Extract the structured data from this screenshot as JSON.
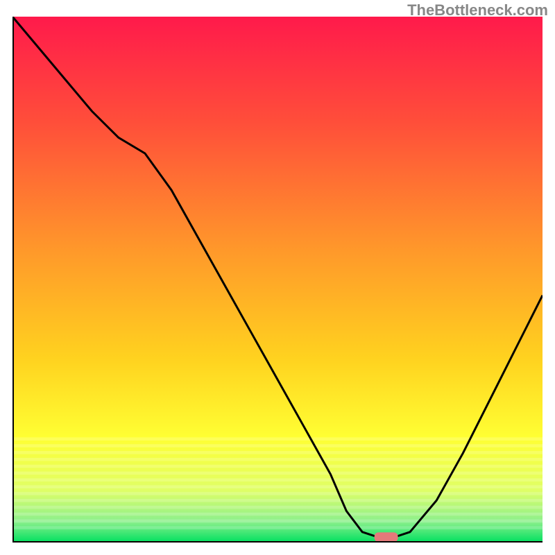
{
  "watermark": "TheBottleneck.com",
  "chart_data": {
    "type": "line",
    "title": "",
    "xlabel": "",
    "ylabel": "",
    "xlim": [
      0,
      100
    ],
    "ylim": [
      0,
      100
    ],
    "grid": false,
    "series": [
      {
        "name": "curve",
        "x": [
          0,
          5,
          10,
          15,
          20,
          25,
          30,
          35,
          40,
          45,
          50,
          55,
          60,
          63,
          66,
          69,
          72,
          75,
          80,
          85,
          90,
          95,
          100
        ],
        "y": [
          100,
          94,
          88,
          82,
          77,
          74,
          67,
          58,
          49,
          40,
          31,
          22,
          13,
          6,
          2,
          1,
          1,
          2,
          8,
          17,
          27,
          37,
          47
        ]
      }
    ],
    "marker": {
      "x": 70.5,
      "y": 1
    },
    "gradient_stops": [
      {
        "offset": 0.0,
        "color": "#ff1a4b"
      },
      {
        "offset": 0.2,
        "color": "#ff4e3a"
      },
      {
        "offset": 0.45,
        "color": "#ff9a2a"
      },
      {
        "offset": 0.65,
        "color": "#ffd21f"
      },
      {
        "offset": 0.8,
        "color": "#ffff33"
      },
      {
        "offset": 0.9,
        "color": "#e0ff66"
      },
      {
        "offset": 0.96,
        "color": "#8cf08c"
      },
      {
        "offset": 1.0,
        "color": "#00e060"
      }
    ],
    "axis_color": "#000000",
    "curve_color": "#000000",
    "marker_color": "#e47a7a"
  }
}
